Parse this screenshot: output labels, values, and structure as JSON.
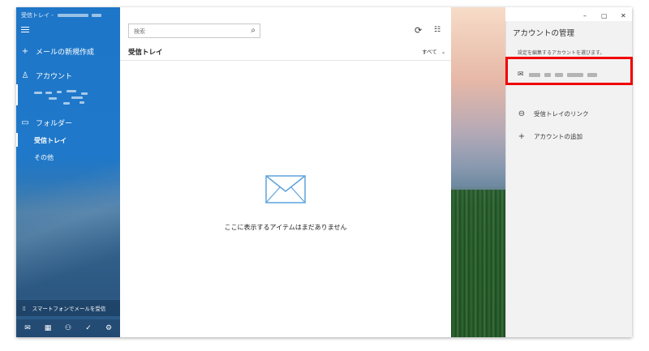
{
  "window": {
    "title": "受信トレイ -",
    "controls": {
      "minimize": "–",
      "restore": "▢",
      "close": "✕"
    }
  },
  "sidebar": {
    "compose_label": "メールの新規作成",
    "accounts_label": "アカウント",
    "folders_label": "フォルダー",
    "folders": [
      {
        "label": "受信トレイ",
        "selected": true
      },
      {
        "label": "その他",
        "selected": false
      }
    ],
    "phone_label": "スマートフォンでメールを受信",
    "icons": {
      "hamburger": "☰",
      "compose": "+",
      "account": "♙",
      "folder": "▭",
      "phone": "▯",
      "mail": "✉",
      "calendar": "▦",
      "people": "⚇",
      "todo": "✓",
      "settings": "⚙"
    }
  },
  "list": {
    "search_placeholder": "検索",
    "title": "受信トレイ",
    "filter_label": "すべて",
    "empty_message": "ここに表示するアイテムはまだありません",
    "icons": {
      "search": "⌕",
      "sync": "⟳",
      "select": "☷",
      "chevron": "⌄"
    }
  },
  "accounts_panel": {
    "title": "アカウントの管理",
    "description": "設定を編集するアカウントを選びます。",
    "link_inboxes_label": "受信トレイのリンク",
    "add_account_label": "アカウントの追加",
    "icons": {
      "mail": "✉",
      "link": "⊖",
      "add": "+"
    }
  },
  "colors": {
    "accent": "#1e76c8",
    "highlight": "#f00000"
  }
}
